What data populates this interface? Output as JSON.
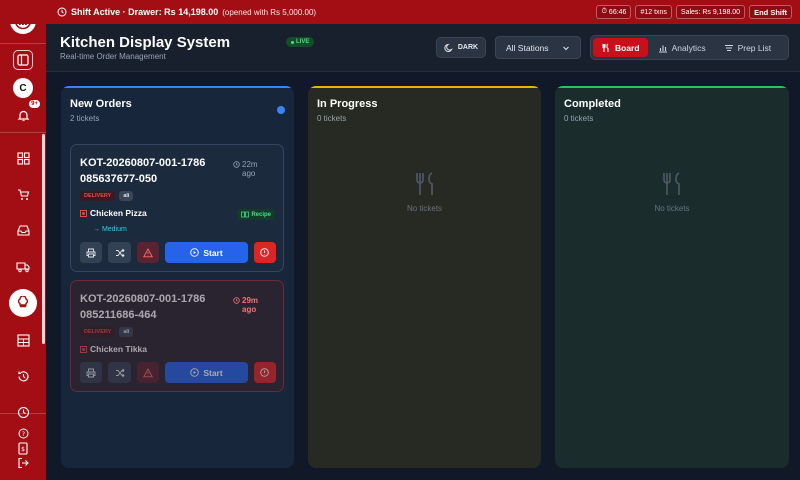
{
  "topbar": {
    "shift_label": "Shift Active · Drawer: Rs 14,198.00",
    "opened_label": "(opened with Rs 5,000.00)",
    "timer": "66:46",
    "txns": "#12 txns",
    "sales": "Sales: Rs 9,198.00",
    "end_shift": "End Shift"
  },
  "sidebar": {
    "avatar_initial": "C",
    "notification_badge": "9+",
    "nav_icons": [
      "dashboard-icon",
      "cart-icon",
      "inbox-icon",
      "truck-icon",
      "chef-hat-icon",
      "table-icon",
      "history-icon",
      "clock-icon",
      "receipt-icon"
    ],
    "active_item": "chef-hat-icon"
  },
  "header": {
    "title": "Kitchen Display System",
    "subtitle": "Real-time Order Management",
    "live_badge": "LIVE",
    "theme_button": "DARK",
    "station_select": "All Stations",
    "tabs": [
      {
        "label": "Board",
        "active": true
      },
      {
        "label": "Analytics",
        "active": false
      },
      {
        "label": "Prep List",
        "active": false
      }
    ]
  },
  "columns": {
    "new": {
      "title": "New Orders",
      "count": "2 tickets",
      "tickets": [
        {
          "kot": "KOT-20260807-001-1786085637677-050",
          "time": "22m ago",
          "type": "DELIVERY",
          "tag": "ali",
          "item": "Chicken Pizza",
          "recipe": "Recipe",
          "modifier": "→ Medium",
          "start": "Start"
        },
        {
          "kot": "KOT-20260807-001-1786085211686-464",
          "time": "29m ago",
          "type": "DELIVERY",
          "tag": "ali",
          "item": "Chicken Tikka",
          "start": "Start"
        }
      ]
    },
    "progress": {
      "title": "In Progress",
      "count": "0 tickets",
      "empty": "No tickets"
    },
    "completed": {
      "title": "Completed",
      "count": "0 tickets",
      "empty": "No tickets"
    }
  },
  "colors": {
    "brand": "#a30d14",
    "new_accent": "#3b82f6",
    "progress_accent": "#eab308",
    "completed_accent": "#22c55e",
    "start_button": "#2563eb",
    "alert_button": "#dc2626"
  }
}
